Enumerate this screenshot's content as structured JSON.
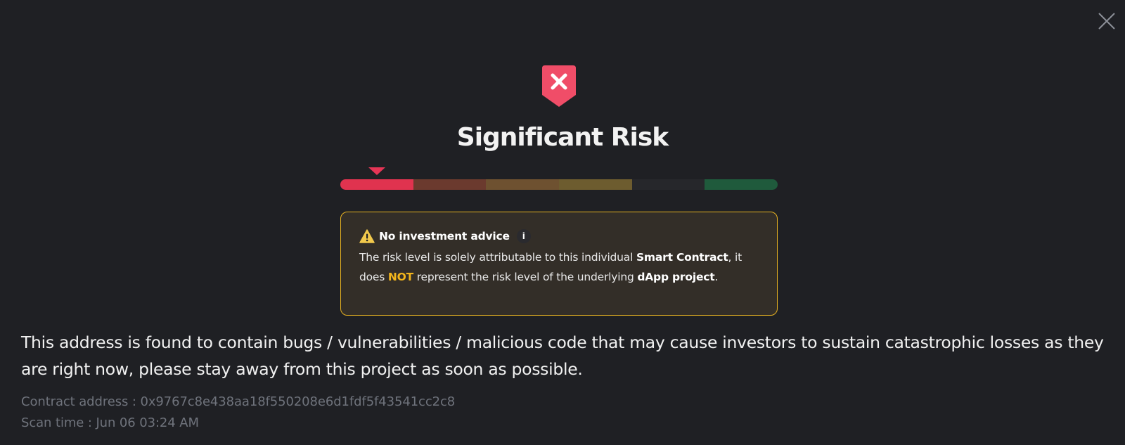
{
  "dialog": {
    "close_icon": "close-icon",
    "status_icon": "shield-x-icon",
    "title": "Significant Risk",
    "accent_color": "#e63556"
  },
  "risk_meter": {
    "level_index": 0,
    "level_count": 6,
    "segments": [
      "#e0334f",
      "#6b3a2e",
      "#6e5130",
      "#6d5c2f",
      "#26272b",
      "#1f5a3c"
    ]
  },
  "notice": {
    "icon": "warning-icon",
    "title": "No investment advice",
    "info_icon": "info-icon",
    "body": {
      "part1": "The risk level is solely attributable to this individual ",
      "bold1": "Smart Contract",
      "part2": ", it does ",
      "highlight": "NOT",
      "part3": " represent the risk level of the underlying ",
      "bold2": "dApp project",
      "part4": "."
    },
    "border_color": "#e7b221"
  },
  "description": "This address is found to contain bugs / vulnerabilities / malicious code that may cause investors to sustain catastrophic losses as they are right now, please stay away from this project as soon as possible.",
  "meta": {
    "contract_label": "Contract address : ",
    "contract_address": "0x9767c8e438aa18f550208e6d1fdf5f43541cc2c8",
    "scan_label": "Scan time : ",
    "scan_time": "Jun 06 03:24 AM"
  }
}
